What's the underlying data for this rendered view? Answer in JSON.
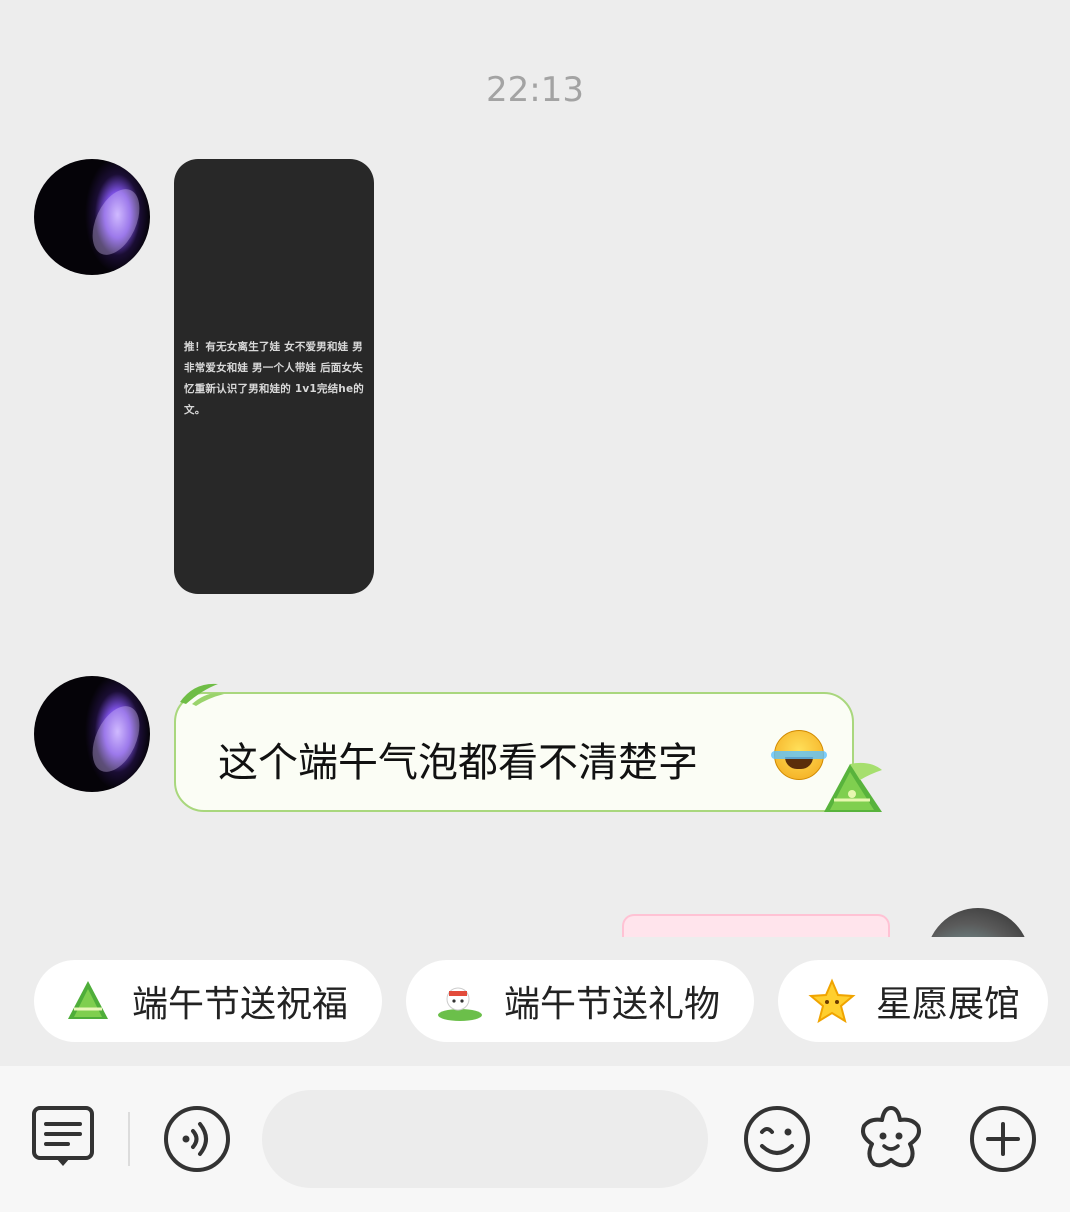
{
  "chat": {
    "timestamp": "22:13",
    "image_message": {
      "text": "推！有无女离生了娃 女不爱男和娃 男非常爱女和娃 男一个人带娃 后面女失忆重新认识了男和娃的 1v1完结he的文。"
    },
    "text_message": {
      "text": "这个端午气泡都看不清楚字",
      "bubble_theme": "端午"
    }
  },
  "quick_actions": [
    {
      "label": "端午节送祝福",
      "icon": "zongzi-icon"
    },
    {
      "label": "端午节送礼物",
      "icon": "dragon-boat-icon"
    },
    {
      "label": "星愿展馆",
      "icon": "star-icon"
    }
  ],
  "input_bar": {
    "message_placeholder": "",
    "icons": [
      "menu-icon",
      "voice-icon",
      "emoji-icon",
      "sticker-star-icon",
      "plus-icon"
    ]
  },
  "colors": {
    "background": "#ededed",
    "bubble_border": "#a9d77d",
    "bubble_fill": "#fbfdf5"
  }
}
